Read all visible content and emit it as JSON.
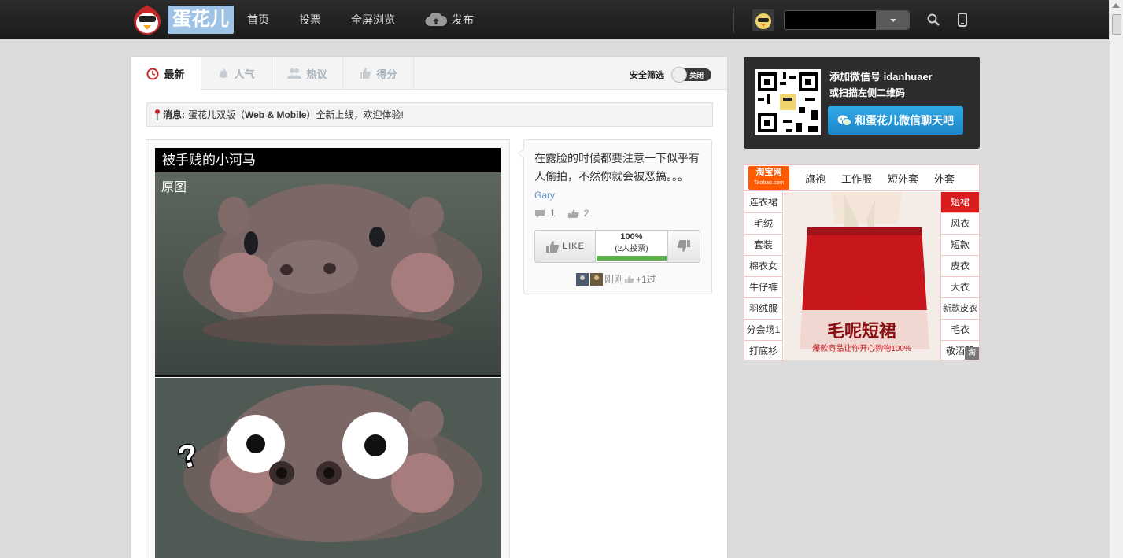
{
  "header": {
    "logo_text": "蛋花儿",
    "nav": [
      "首页",
      "投票",
      "全屏浏览",
      "发布"
    ]
  },
  "tabs": [
    {
      "label": "最新",
      "icon": "clock-icon",
      "active": true
    },
    {
      "label": "人气",
      "icon": "flame-icon",
      "active": false
    },
    {
      "label": "热议",
      "icon": "people-icon",
      "active": false
    },
    {
      "label": "得分",
      "icon": "thumb-icon",
      "active": false
    }
  ],
  "safe_filter": {
    "label": "安全筛选",
    "state": "关闭"
  },
  "notice": {
    "prefix": "消息:",
    "text_before": "蛋花儿双版（",
    "bold": "Web & Mobile",
    "text_after": "）全新上线，欢迎体验!"
  },
  "post": {
    "title": "被手贱的小河马",
    "image_caption": "原图"
  },
  "comment": {
    "text": "在露脸的时候都要注意一下似乎有人偷拍，不然你就会被恶搞。。。",
    "author": "Gary",
    "comments": "1",
    "likes": "2",
    "like_label": "LIKE",
    "percent": "100%",
    "votes_text": "(2人投票)",
    "positive_ratio": 1.0,
    "voters_text": "刚刚",
    "plus_text": "+1过"
  },
  "wechat": {
    "line1": "添加微信号 idanhuaer",
    "line2": "或扫描左侧二维码",
    "button": "和蛋花儿微信聊天吧"
  },
  "taobao": {
    "logo": "淘宝网",
    "logo_sub": "Taobao.com",
    "top_links": [
      "旗袍",
      "工作服",
      "短外套",
      "外套"
    ],
    "left": [
      "连衣裙",
      "毛绒",
      "套装",
      "棉衣女",
      "牛仔裤",
      "羽绒服",
      "分会场1",
      "打底衫"
    ],
    "right": [
      "短裙",
      "风衣",
      "短款",
      "皮衣",
      "大衣",
      "新款皮衣",
      "毛衣",
      "敬酒服"
    ],
    "product_title": "毛呢短裙",
    "product_sub": "爆款商品让你开心购物100%",
    "product_tag": "淘宝",
    "badge": "淘",
    "colors": {
      "accent": "#d91c1c",
      "logo": "#ff5a00"
    }
  }
}
